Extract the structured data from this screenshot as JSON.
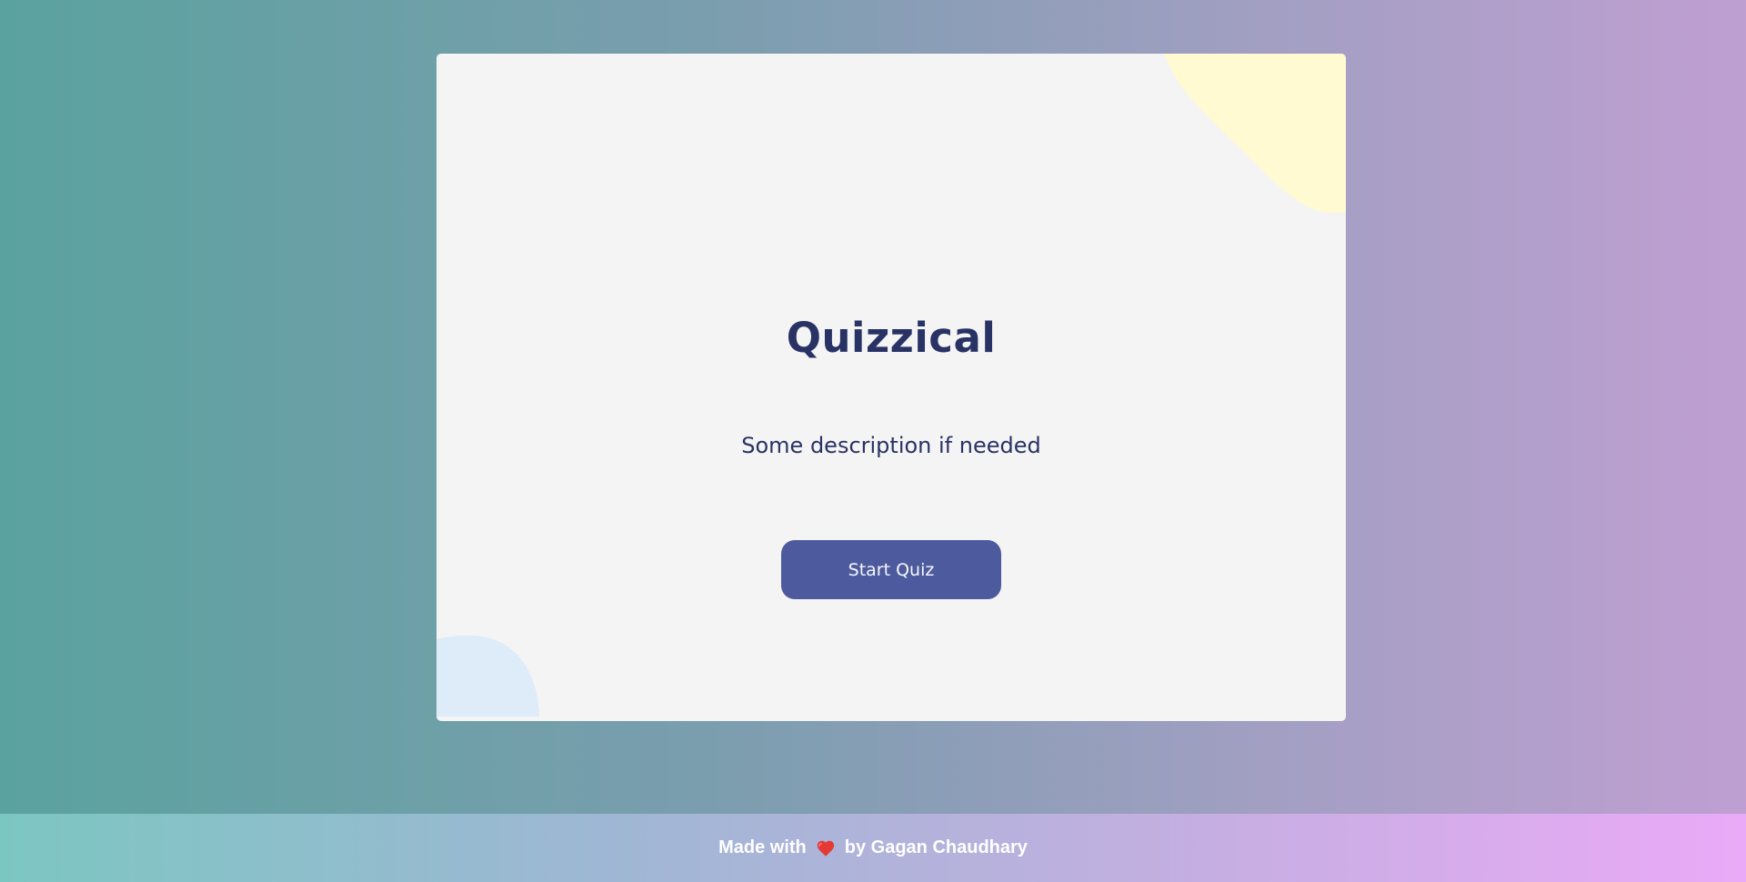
{
  "card": {
    "title": "Quizzical",
    "description": "Some description if needed",
    "start_button_label": "Start Quiz"
  },
  "footer": {
    "prefix": "Made with",
    "heart_icon": "heart-icon",
    "suffix": "by Gagan Chaudhary"
  },
  "colors": {
    "title_text": "#293264",
    "button_bg": "#4d5b9e",
    "card_bg": "#f4f4f4",
    "blob_top": "#fffad1",
    "blob_bottom": "#deebf8",
    "heart": "#e53935"
  }
}
